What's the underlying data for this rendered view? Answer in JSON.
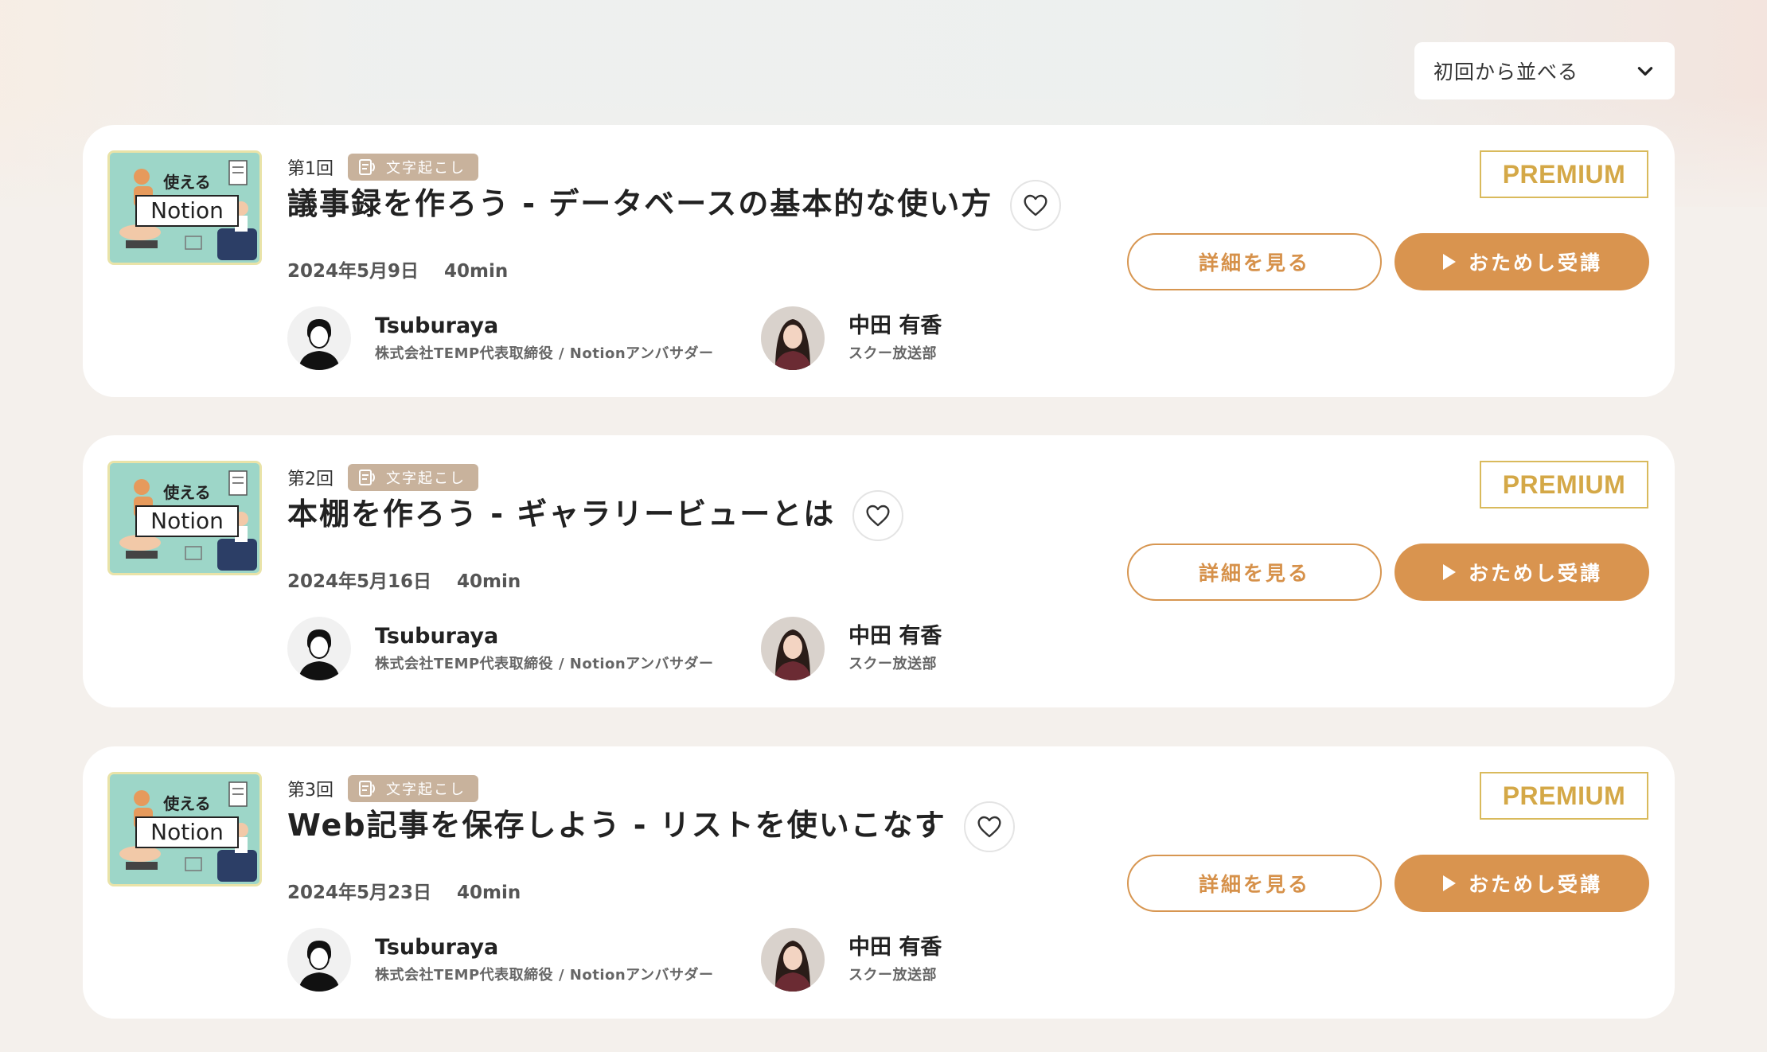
{
  "sort": {
    "label": "初回から並べる"
  },
  "episodes": [
    {
      "number": "第1回",
      "tag": "文字起こし",
      "title": "議事録を作ろう - データベースの基本的な使い方",
      "date": "2024年5月9日",
      "duration": "40min",
      "badge": "PREMIUM",
      "detail_label": "詳細を見る",
      "trial_label": "おためし受講",
      "thumb_line1": "使える",
      "thumb_line2": "Notion",
      "instructor": {
        "name": "Tsuburaya",
        "role": "株式会社TEMP代表取締役 / Notionアンバサダー"
      },
      "host": {
        "name": "中田 有香",
        "role": "スクー放送部"
      }
    },
    {
      "number": "第2回",
      "tag": "文字起こし",
      "title": "本棚を作ろう - ギャラリービューとは",
      "date": "2024年5月16日",
      "duration": "40min",
      "badge": "PREMIUM",
      "detail_label": "詳細を見る",
      "trial_label": "おためし受講",
      "thumb_line1": "使える",
      "thumb_line2": "Notion",
      "instructor": {
        "name": "Tsuburaya",
        "role": "株式会社TEMP代表取締役 / Notionアンバサダー"
      },
      "host": {
        "name": "中田 有香",
        "role": "スクー放送部"
      }
    },
    {
      "number": "第3回",
      "tag": "文字起こし",
      "title": "Web記事を保存しよう - リストを使いこなす",
      "date": "2024年5月23日",
      "duration": "40min",
      "badge": "PREMIUM",
      "detail_label": "詳細を見る",
      "trial_label": "おためし受講",
      "thumb_line1": "使える",
      "thumb_line2": "Notion",
      "instructor": {
        "name": "Tsuburaya",
        "role": "株式会社TEMP代表取締役 / Notionアンバサダー"
      },
      "host": {
        "name": "中田 有香",
        "role": "スクー放送部"
      }
    }
  ],
  "colors": {
    "accent": "#d9944f",
    "premium": "#d4a847",
    "tag_bg": "#c8b29c",
    "thumb_bg": "#9dd6c8"
  }
}
